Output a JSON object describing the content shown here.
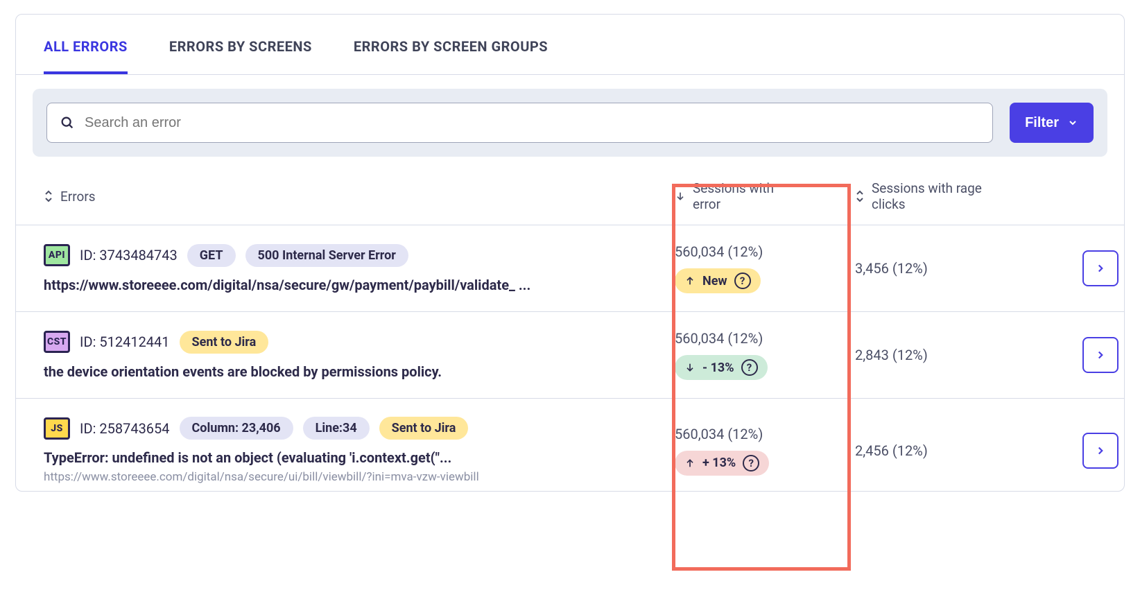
{
  "tabs": {
    "all_errors": "ALL ERRORS",
    "by_screens": "ERRORS BY SCREENS",
    "by_groups": "ERRORS BY SCREEN GROUPS"
  },
  "search": {
    "placeholder": "Search an error"
  },
  "filter": {
    "label": "Filter"
  },
  "columns": {
    "errors": "Errors",
    "sessions_with_error": "Sessions with error",
    "sessions_rage": "Sessions with rage clicks"
  },
  "rows": [
    {
      "type": "API",
      "id_label": "ID: 3743484743",
      "pills": [
        {
          "text": "GET",
          "variant": "default"
        },
        {
          "text": "500 Internal Server Error",
          "variant": "default"
        }
      ],
      "title": "https://www.storeeee.com/digital/nsa/secure/gw/payment/paybill/validate_ ...",
      "subtitle": "",
      "sessions": "560,034 (12%)",
      "trend": {
        "kind": "new",
        "text": "New"
      },
      "rage": "3,456 (12%)"
    },
    {
      "type": "CST",
      "id_label": "ID: 512412441",
      "pills": [
        {
          "text": "Sent to Jira",
          "variant": "yellow"
        }
      ],
      "title": "the device orientation events are blocked by permissions policy.",
      "subtitle": "",
      "sessions": "560,034 (12%)",
      "trend": {
        "kind": "down",
        "text": "- 13%"
      },
      "rage": "2,843 (12%)"
    },
    {
      "type": "JS",
      "id_label": "ID: 258743654",
      "pills": [
        {
          "text": "Column: 23,406",
          "variant": "default"
        },
        {
          "text": "Line:34",
          "variant": "default"
        },
        {
          "text": "Sent to Jira",
          "variant": "yellow"
        }
      ],
      "title": "TypeError: undefined is not an object (evaluating 'i.context.get(\"...",
      "subtitle": "https://www.storeeee.com/digital/nsa/secure/ui/bill/viewbill/?ini=mva-vzw-viewbill",
      "sessions": "560,034 (12%)",
      "trend": {
        "kind": "up",
        "text": "+ 13%"
      },
      "rage": "2,456 (12%)"
    }
  ]
}
